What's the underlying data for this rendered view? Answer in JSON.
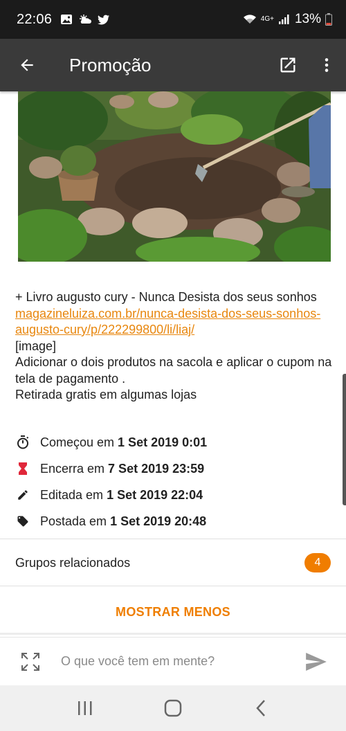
{
  "status_bar": {
    "time": "22:06",
    "network": "4G+",
    "battery": "13%"
  },
  "app_bar": {
    "title": "Promoção"
  },
  "post": {
    "desc_line1": "+ Livro augusto cury - Nunca Desista dos seus sonhos ",
    "link_text": "magazineluiza.com.br/nunca-desista-dos-seus-sonhos-augusto-cury/p/222299800/li/liaj/",
    "image_tag": "[image]",
    "instructions": "Adicionar o dois produtos na sacola e aplicar o cupom na tela de pagamento .",
    "pickup": "Retirada gratis em algumas lojas"
  },
  "meta": {
    "started_label": "Começou em",
    "started_value": "1 Set 2019 0:01",
    "ends_label": "Encerra em",
    "ends_value": "7 Set 2019 23:59",
    "edited_label": "Editada em",
    "edited_value": "1 Set 2019 22:04",
    "posted_label": "Postada em",
    "posted_value": "1 Set 2019 20:48"
  },
  "groups": {
    "label": "Grupos relacionados",
    "count": "4"
  },
  "show_less_label": "MOSTRAR MENOS",
  "comment": {
    "placeholder": "O que você tem em mente?"
  },
  "colors": {
    "accent": "#ef7e00",
    "app_bar": "#3a3a3a",
    "status_bar": "#1b1b1b"
  }
}
